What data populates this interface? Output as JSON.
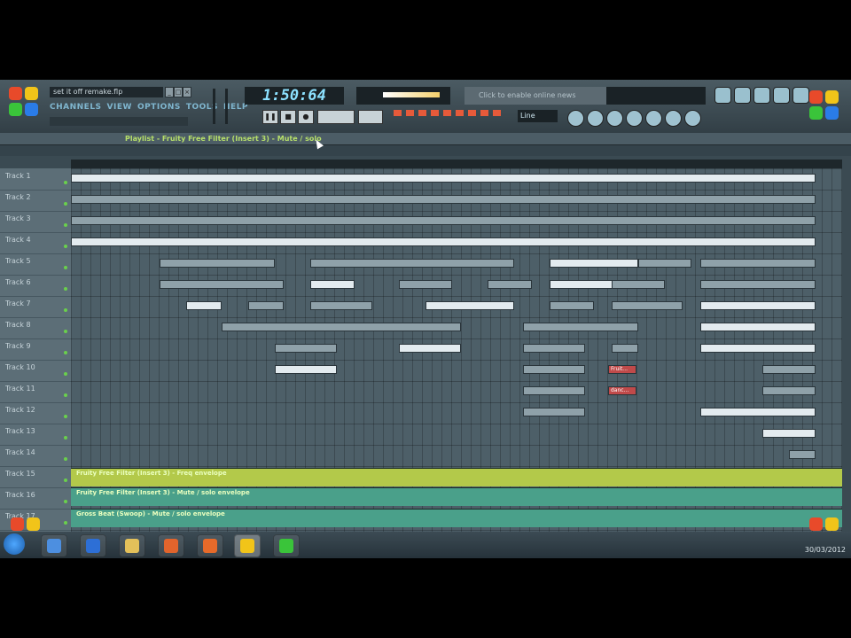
{
  "app": {
    "filename": "set it off remake.flp",
    "time": "1:50:64",
    "news_hint": "Click to enable online news",
    "line_select": "Line"
  },
  "menu": [
    "CHANNELS",
    "VIEW",
    "OPTIONS",
    "TOOLS",
    "HELP"
  ],
  "playlist": {
    "title": "Playlist - Fruity Free Filter (Insert 3) - Mute / solo"
  },
  "tracks": [
    "Track 1",
    "Track 2",
    "Track 3",
    "Track 4",
    "Track 5",
    "Track 6",
    "Track 7",
    "Track 8",
    "Track 9",
    "Track 10",
    "Track 11",
    "Track 12",
    "Track 13",
    "Track 14",
    "Track 15",
    "Track 16",
    "Track 17"
  ],
  "automation": [
    {
      "label": "Fruity Free Filter (Insert 3) - Freq envelope"
    },
    {
      "label": "Fruity Free Filter (Insert 3) - Mute / solo envelope"
    },
    {
      "label": "Gross Beat (Swoop) - Mute / solo envelope"
    }
  ],
  "clip_labels": {
    "fruity": "Fruit...",
    "dance": "danc..."
  },
  "taskbar": {
    "date": "30/03/2012"
  },
  "colors": {
    "accent": "#b7e06a",
    "grid": "#4d5f68",
    "automation": "#4aa08a"
  }
}
